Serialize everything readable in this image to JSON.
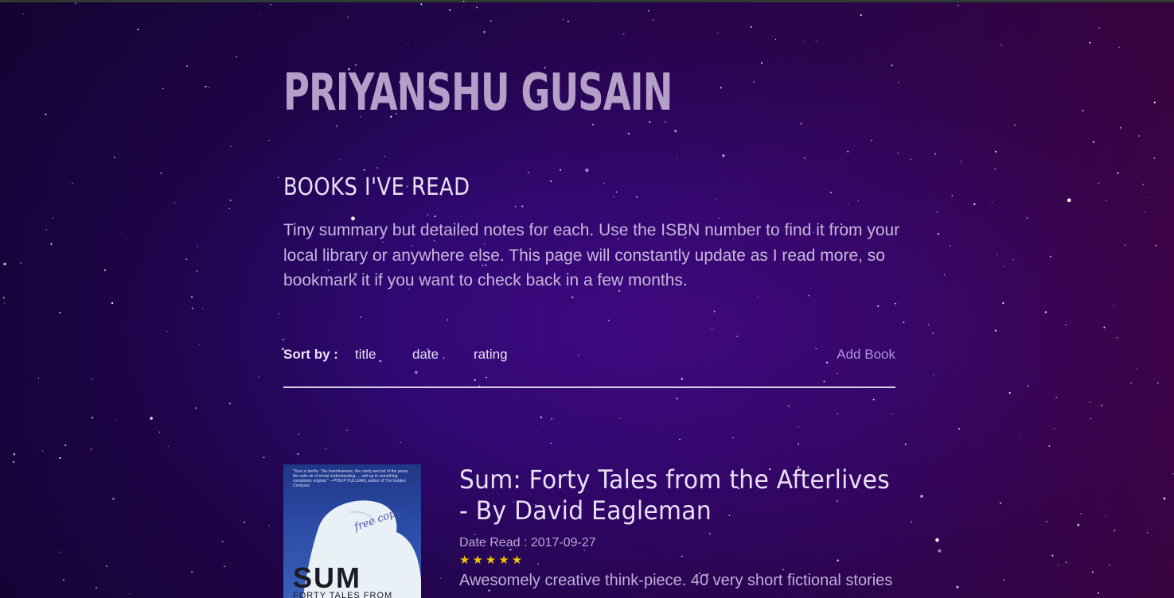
{
  "site": {
    "title": "PRIYANSHU GUSAIN"
  },
  "section": {
    "title": "BOOKS I'VE READ",
    "intro": "Tiny summary but detailed notes for each. Use the ISBN number to find it from your local library or anywhere else. This page will constantly update as I read more, so bookmark it if you want to check back in a few months."
  },
  "sort": {
    "label": "Sort by :",
    "options": [
      "title",
      "date",
      "rating"
    ],
    "add_book_label": "Add Book"
  },
  "books": [
    {
      "title_line1": "Sum: Forty Tales from the Afterlives",
      "title_line2": "- By David Eagleman",
      "date_read": "Date Read : 2017-09-27",
      "rating_stars": "★★★★★",
      "rating_value": 5,
      "summary": "Awesomely creative think-piece. 40 very short fictional stories",
      "cover": {
        "blurb": "\"Sum is terrific. The inventiveness, the clarity and wit of the prose, the calm air of moral understanding … add up to something completely original.\" —PHILIP PULLMAN, author of The Golden Compass",
        "handwriting": "free copy",
        "title": "SUM",
        "subtitle": "FORTY TALES FROM"
      }
    }
  ],
  "colors": {
    "background_primary": "#2f0872",
    "title": "#b49fc9",
    "accent_link": "#ab93db",
    "star": "#f1c400"
  }
}
